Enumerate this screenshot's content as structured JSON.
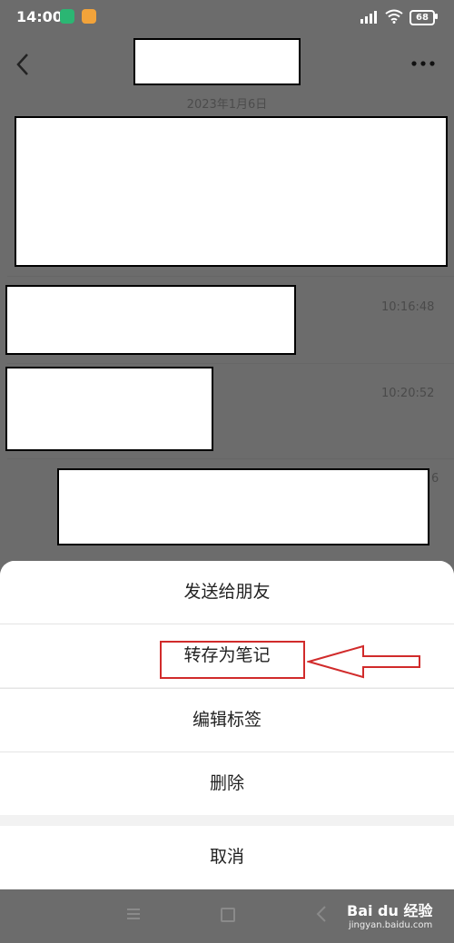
{
  "status_bar": {
    "time": "14:00",
    "battery": "68"
  },
  "chat": {
    "date": "2023年1月6日",
    "timestamps": [
      "10:16:48",
      "10:20:52",
      "6"
    ]
  },
  "sheet": {
    "items": [
      "发送给朋友",
      "转存为笔记",
      "编辑标签",
      "删除"
    ],
    "cancel": "取消"
  },
  "watermark": {
    "brand": "Bai du 经验",
    "url": "jingyan.baidu.com"
  },
  "colors": {
    "highlight": "#d12b2b",
    "overlay": "#6c6c6c"
  }
}
